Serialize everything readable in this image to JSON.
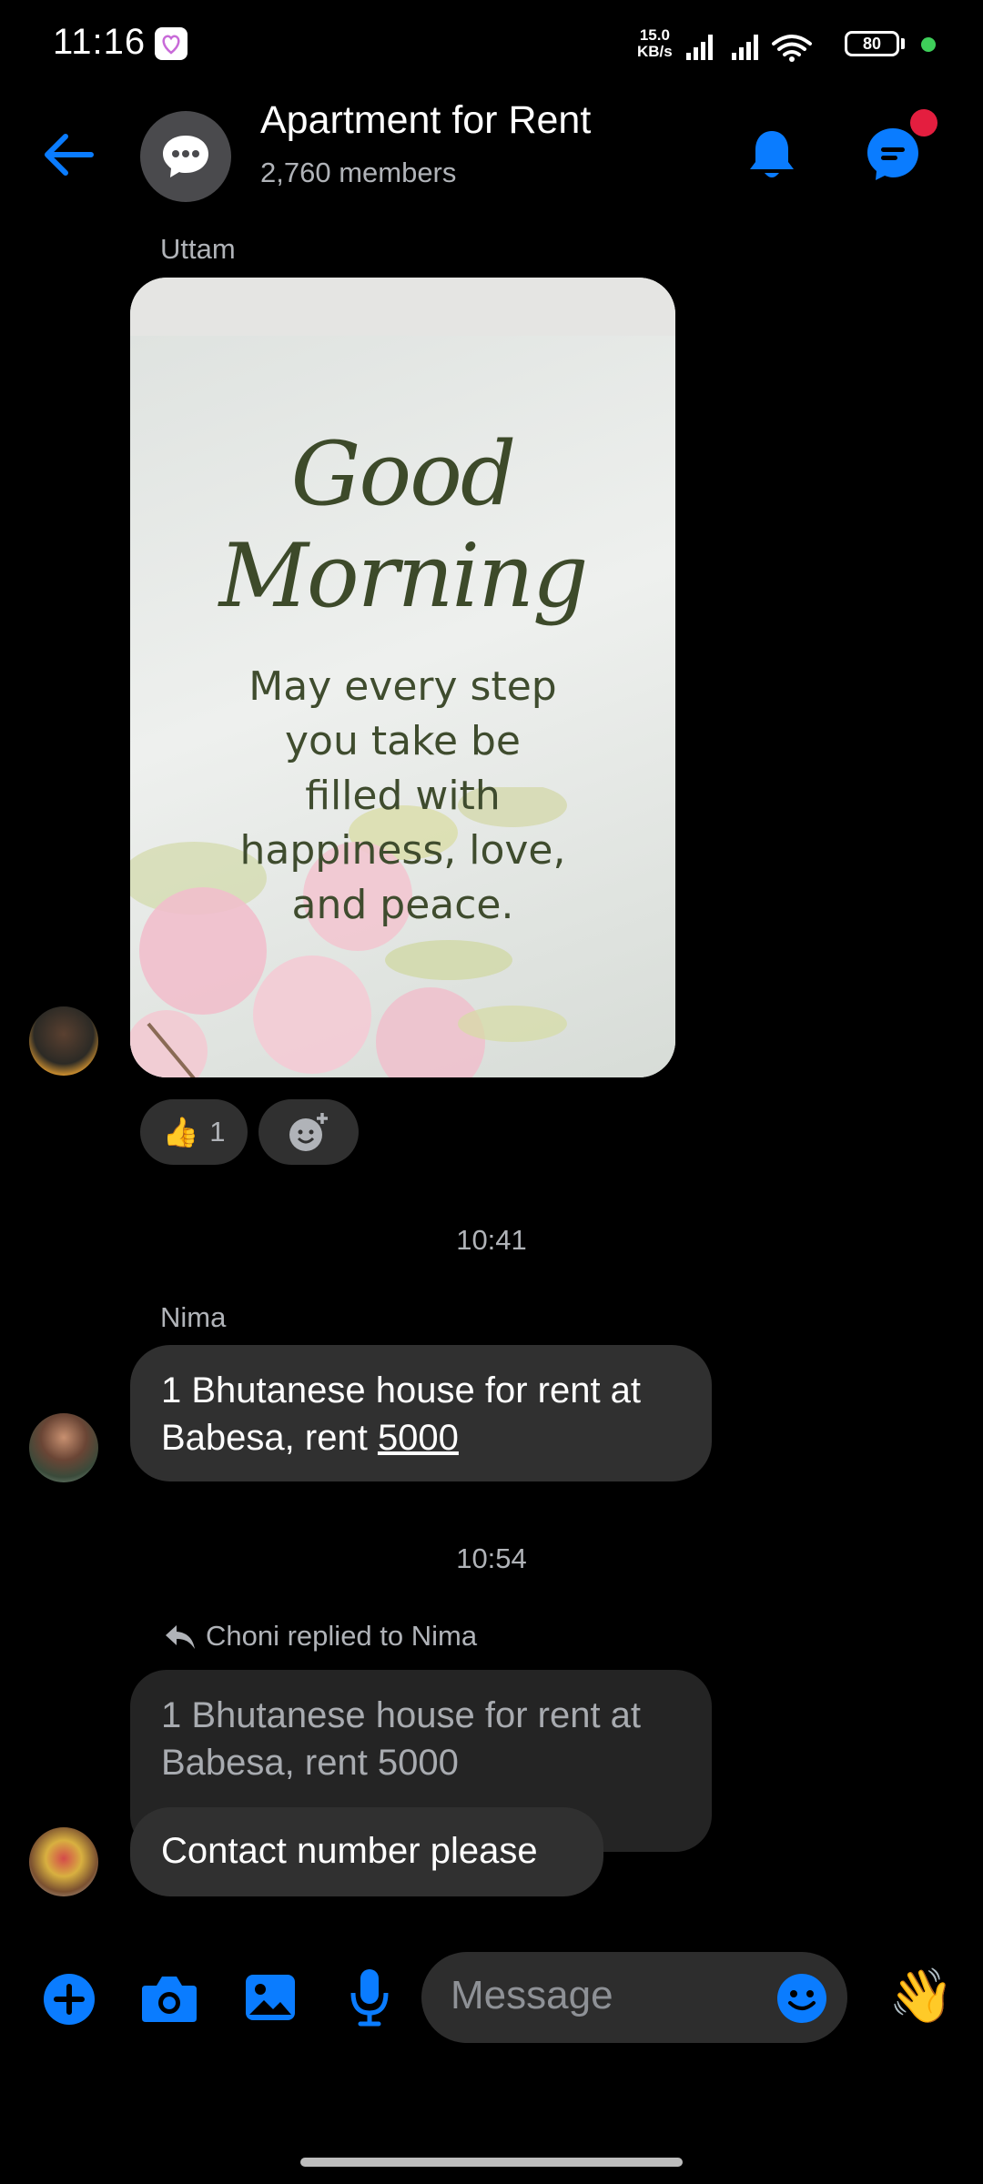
{
  "status_bar": {
    "time": "11:16",
    "net_speed_value": "15.0",
    "net_speed_unit": "KB/s",
    "battery": "80"
  },
  "header": {
    "title": "Apartment for Rent",
    "members": "2,760 members"
  },
  "messages": [
    {
      "sender": "Uttam",
      "card_title": "Good Morning",
      "card_lines": [
        "May every step",
        "you take be",
        "filled with",
        "happiness, love,",
        "and peace."
      ],
      "reactions": {
        "thumbs_count": "1"
      }
    },
    {
      "timestamp": "10:41"
    },
    {
      "sender": "Nima",
      "text_line1": "1 Bhutanese house for rent at",
      "text_line2_prefix": "Babesa, rent ",
      "text_line2_link": "5000"
    },
    {
      "timestamp": "10:54"
    },
    {
      "reply_label": "Choni replied to Nima",
      "quoted_line1": "1 Bhutanese house for rent at",
      "quoted_line2": "Babesa, rent 5000",
      "text": "Contact number please"
    }
  ],
  "composer": {
    "placeholder": "Message"
  },
  "colors": {
    "accent": "#0a7cff",
    "bubble": "#303030",
    "background": "#000000",
    "notification_dot": "#e41e3f"
  },
  "icons": [
    "back-arrow-icon",
    "group-chat-icon",
    "bell-icon",
    "messenger-icon",
    "add-icon",
    "camera-icon",
    "gallery-icon",
    "microphone-icon",
    "emoji-icon",
    "wave-icon",
    "reaction-add-icon"
  ]
}
